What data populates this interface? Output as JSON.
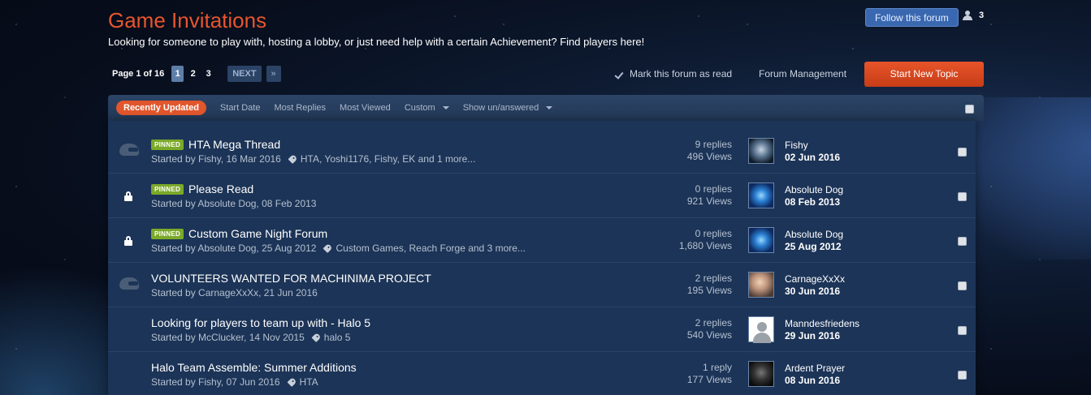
{
  "forum": {
    "title": "Game Invitations",
    "description": "Looking for someone to play with, hosting a lobby, or just need help with a certain Achievement? Find players here!",
    "follow_label": "Follow this forum",
    "follower_count": "3"
  },
  "pagination": {
    "info": "Page 1 of 16",
    "pages": [
      "1",
      "2",
      "3"
    ],
    "next_label": "NEXT",
    "last_label": "»"
  },
  "actions": {
    "mark_read": "Mark this forum as read",
    "forum_management": "Forum Management",
    "start_topic": "Start New Topic"
  },
  "sort_tabs": {
    "recently_updated": "Recently Updated",
    "start_date": "Start Date",
    "most_replies": "Most Replies",
    "most_viewed": "Most Viewed",
    "custom": "Custom",
    "show_unanswered": "Show un/answered"
  },
  "topics": [
    {
      "pinned": "PINNED",
      "title": "HTA Mega Thread",
      "started": "Started by Fishy, 16 Mar 2016",
      "tags": "HTA, Yoshi1176, Fishy, EK and 1 more...",
      "replies": "9 replies",
      "views": "496 Views",
      "last_poster": "Fishy",
      "last_date": "02 Jun 2016"
    },
    {
      "pinned": "PINNED",
      "title": "Please Read",
      "started": "Started by Absolute Dog, 08 Feb 2013",
      "replies": "0 replies",
      "views": "921 Views",
      "last_poster": "Absolute Dog",
      "last_date": "08 Feb 2013"
    },
    {
      "pinned": "PINNED",
      "title": "Custom Game Night Forum",
      "started": "Started by Absolute Dog, 25 Aug 2012",
      "tags": "Custom Games, Reach Forge and 3 more...",
      "replies": "0 replies",
      "views": "1,680 Views",
      "last_poster": "Absolute Dog",
      "last_date": "25 Aug 2012"
    },
    {
      "title": "VOLUNTEERS WANTED FOR MACHINIMA PROJECT",
      "started": "Started by CarnageXxXx, 21 Jun 2016",
      "replies": "2 replies",
      "views": "195 Views",
      "last_poster": "CarnageXxXx",
      "last_date": "30 Jun 2016"
    },
    {
      "title": "Looking for players to team up with - Halo 5",
      "started": "Started by McClucker, 14 Nov 2015",
      "tags": "halo 5",
      "replies": "2 replies",
      "views": "540 Views",
      "last_poster": "Manndesfriedens",
      "last_date": "29 Jun 2016"
    },
    {
      "title": "Halo Team Assemble: Summer Additions",
      "started": "Started by Fishy, 07 Jun 2016",
      "tags": "HTA",
      "replies": "1 reply",
      "views": "177 Views",
      "last_poster": "Ardent Prayer",
      "last_date": "08 Jun 2016"
    }
  ],
  "colors": {
    "accent_orange": "#e1562c",
    "pinned_green": "#7ba92a",
    "follow_blue": "#3a68b0",
    "panel_bg": "#1c3457"
  }
}
